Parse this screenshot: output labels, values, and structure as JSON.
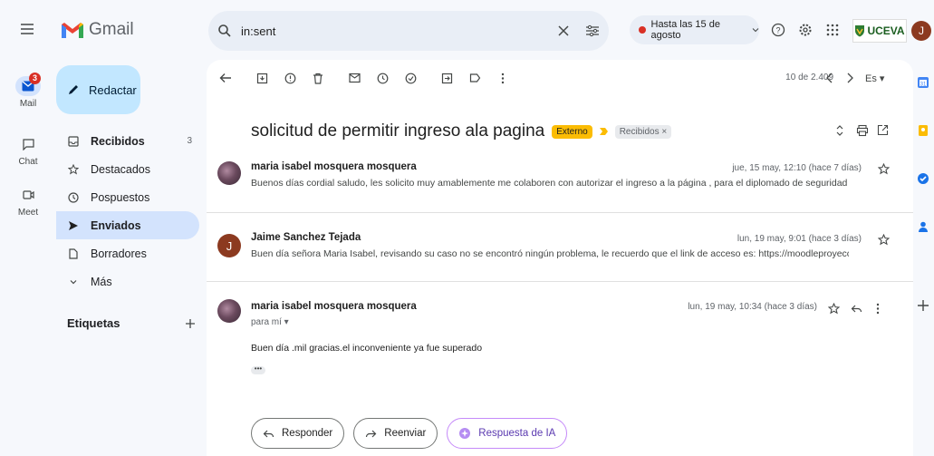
{
  "rail": {
    "mail_label": "Mail",
    "mail_badge": "3",
    "chat_label": "Chat",
    "meet_label": "Meet"
  },
  "app": {
    "name": "Gmail"
  },
  "compose": {
    "label": "Redactar"
  },
  "nav": {
    "items": [
      {
        "label": "Recibidos",
        "count": "3"
      },
      {
        "label": "Destacados"
      },
      {
        "label": "Pospuestos"
      },
      {
        "label": "Enviados"
      },
      {
        "label": "Borradores"
      },
      {
        "label": "Más"
      }
    ],
    "labels_heading": "Etiquetas"
  },
  "search": {
    "value": "in:sent"
  },
  "status": {
    "label": "Hasta las 15 de agosto"
  },
  "org": {
    "logo_text": "UCEVA"
  },
  "user": {
    "initial": "J"
  },
  "toolbar": {
    "pager": "10 de 2.409",
    "lang": "Es"
  },
  "thread": {
    "subject": "solicitud de permitir ingreso ala pagina",
    "tag_external": "Externo",
    "tag_inbox": "Recibidos ×",
    "messages": [
      {
        "sender": "maria isabel mosquera mosquera",
        "date": "jue, 15 may, 12:10 (hace 7 días)",
        "snippet": "Buenos días cordial saludo, les solicito muy amablemente me colaboren con autorizar el ingreso a la página , para el diplomado de seguridad y convivencia ciudad"
      },
      {
        "sender": "Jaime Sanchez Tejada",
        "initial": "J",
        "date": "lun, 19 may, 9:01 (hace 3 días)",
        "snippet": "Buen día señora Maria Isabel, revisando su caso no se encontró ningún problema, le recuerdo que el link de acceso es: https://moodleproyeccionsocial.uceva.edu.c"
      },
      {
        "sender": "maria isabel mosquera mosquera",
        "date": "lun, 19 may, 10:34 (hace 3 días)",
        "to": "para mí ▾",
        "body": "Buen día .mil gracias.el inconveniente ya fue superado",
        "ellipsis": "•••"
      }
    ]
  },
  "actions": {
    "reply": "Responder",
    "forward": "Reenviar",
    "ai": "Respuesta de IA"
  },
  "colors": {
    "accent": "#c2e7ff",
    "active_nav": "#d3e3fd",
    "external_tag": "#fbbc04"
  }
}
